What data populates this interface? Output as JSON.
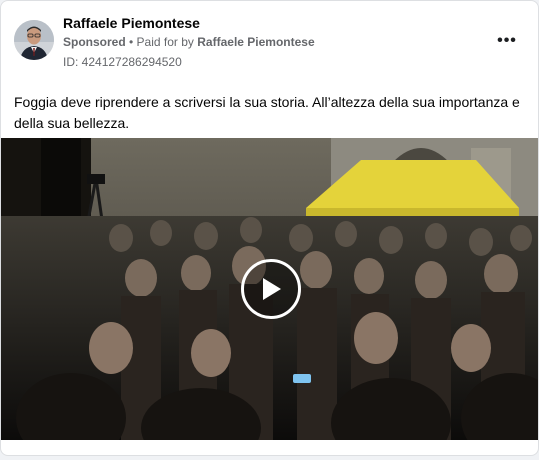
{
  "post": {
    "author": "Raffaele Piemontese",
    "sponsored_label": "Sponsored",
    "paid_prefix": "• Paid for by",
    "payer": "Raffaele Piemontese",
    "ad_id": "ID: 424127286294520",
    "text": "Foggia deve riprendere a scriversi la sua storia. All’altezza della sua importanza e della sua bellezza."
  },
  "icons": {
    "more": "more-options-icon",
    "play": "play-icon"
  },
  "colors": {
    "author": "#050505",
    "meta": "#65676b",
    "card_border": "#dddfe2",
    "tent": "#e4d33a"
  }
}
